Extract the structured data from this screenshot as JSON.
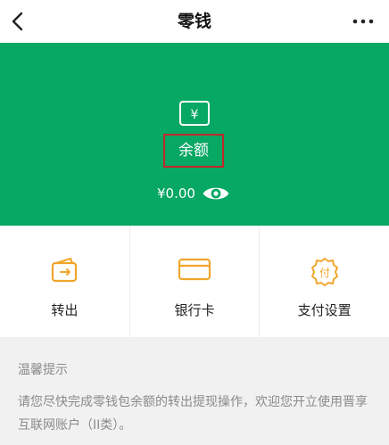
{
  "header": {
    "title": "零钱",
    "back_icon": "chevron-left-icon",
    "more_icon": "more-dots-icon"
  },
  "balance": {
    "icon": "wallet-yuan-icon",
    "icon_glyph": "¥",
    "label": "余额",
    "amount": "¥0.00",
    "visibility_icon": "eye-icon"
  },
  "actions": [
    {
      "label": "转出",
      "icon": "wallet-transfer-icon"
    },
    {
      "label": "银行卡",
      "icon": "bank-card-icon"
    },
    {
      "label": "支付设置",
      "icon": "pay-settings-gear-icon",
      "icon_glyph": "付"
    }
  ],
  "tips": {
    "title": "温馨提示",
    "body": "请您尽快完成零钱包余额的转出提现操作，欢迎您开立使用晋享互联网账户（II类）。"
  },
  "colors": {
    "hero_green": "#07a764",
    "icon_orange": "#f0a62c",
    "highlight_red": "#c0282a"
  }
}
